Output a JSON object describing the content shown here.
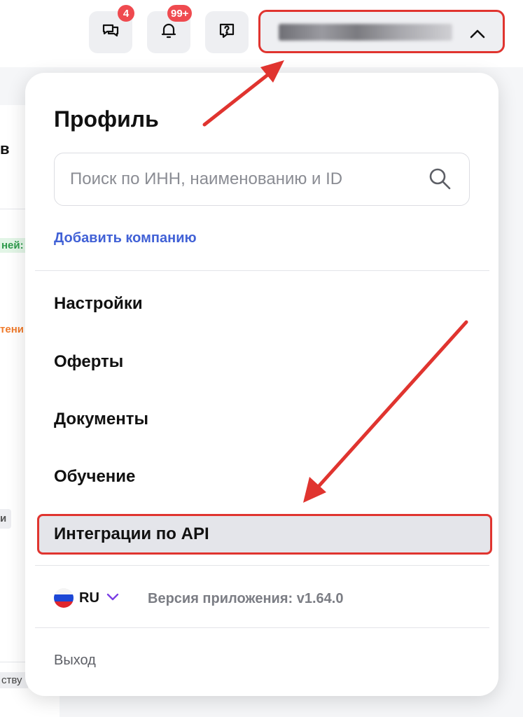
{
  "header": {
    "chat_badge": "4",
    "notifications_badge": "99+"
  },
  "background": {
    "frag_title": "в",
    "frag_green": "ней:",
    "frag_orange": "тени",
    "frag_grey": "и",
    "frag_bottom": "ству"
  },
  "profile_menu": {
    "title": "Профиль",
    "search_placeholder": "Поиск по ИНН, наименованию и ID",
    "add_company": "Добавить компанию",
    "items": [
      {
        "label": "Настройки"
      },
      {
        "label": "Оферты"
      },
      {
        "label": "Документы"
      },
      {
        "label": "Обучение"
      },
      {
        "label": "Интеграции по API"
      }
    ],
    "language": "RU",
    "version": "Версия приложения: v1.64.0",
    "logout": "Выход"
  },
  "icons": [
    "chat-icon",
    "bell-icon",
    "help-icon",
    "chevron-up-icon",
    "search-icon",
    "chevron-down-icon",
    "russian-flag-icon"
  ],
  "colors": {
    "accent_link": "#4161d6",
    "badge": "#ef4a4f",
    "annotation_red": "#e0342f",
    "lang_chevron": "#7b3fe4"
  }
}
